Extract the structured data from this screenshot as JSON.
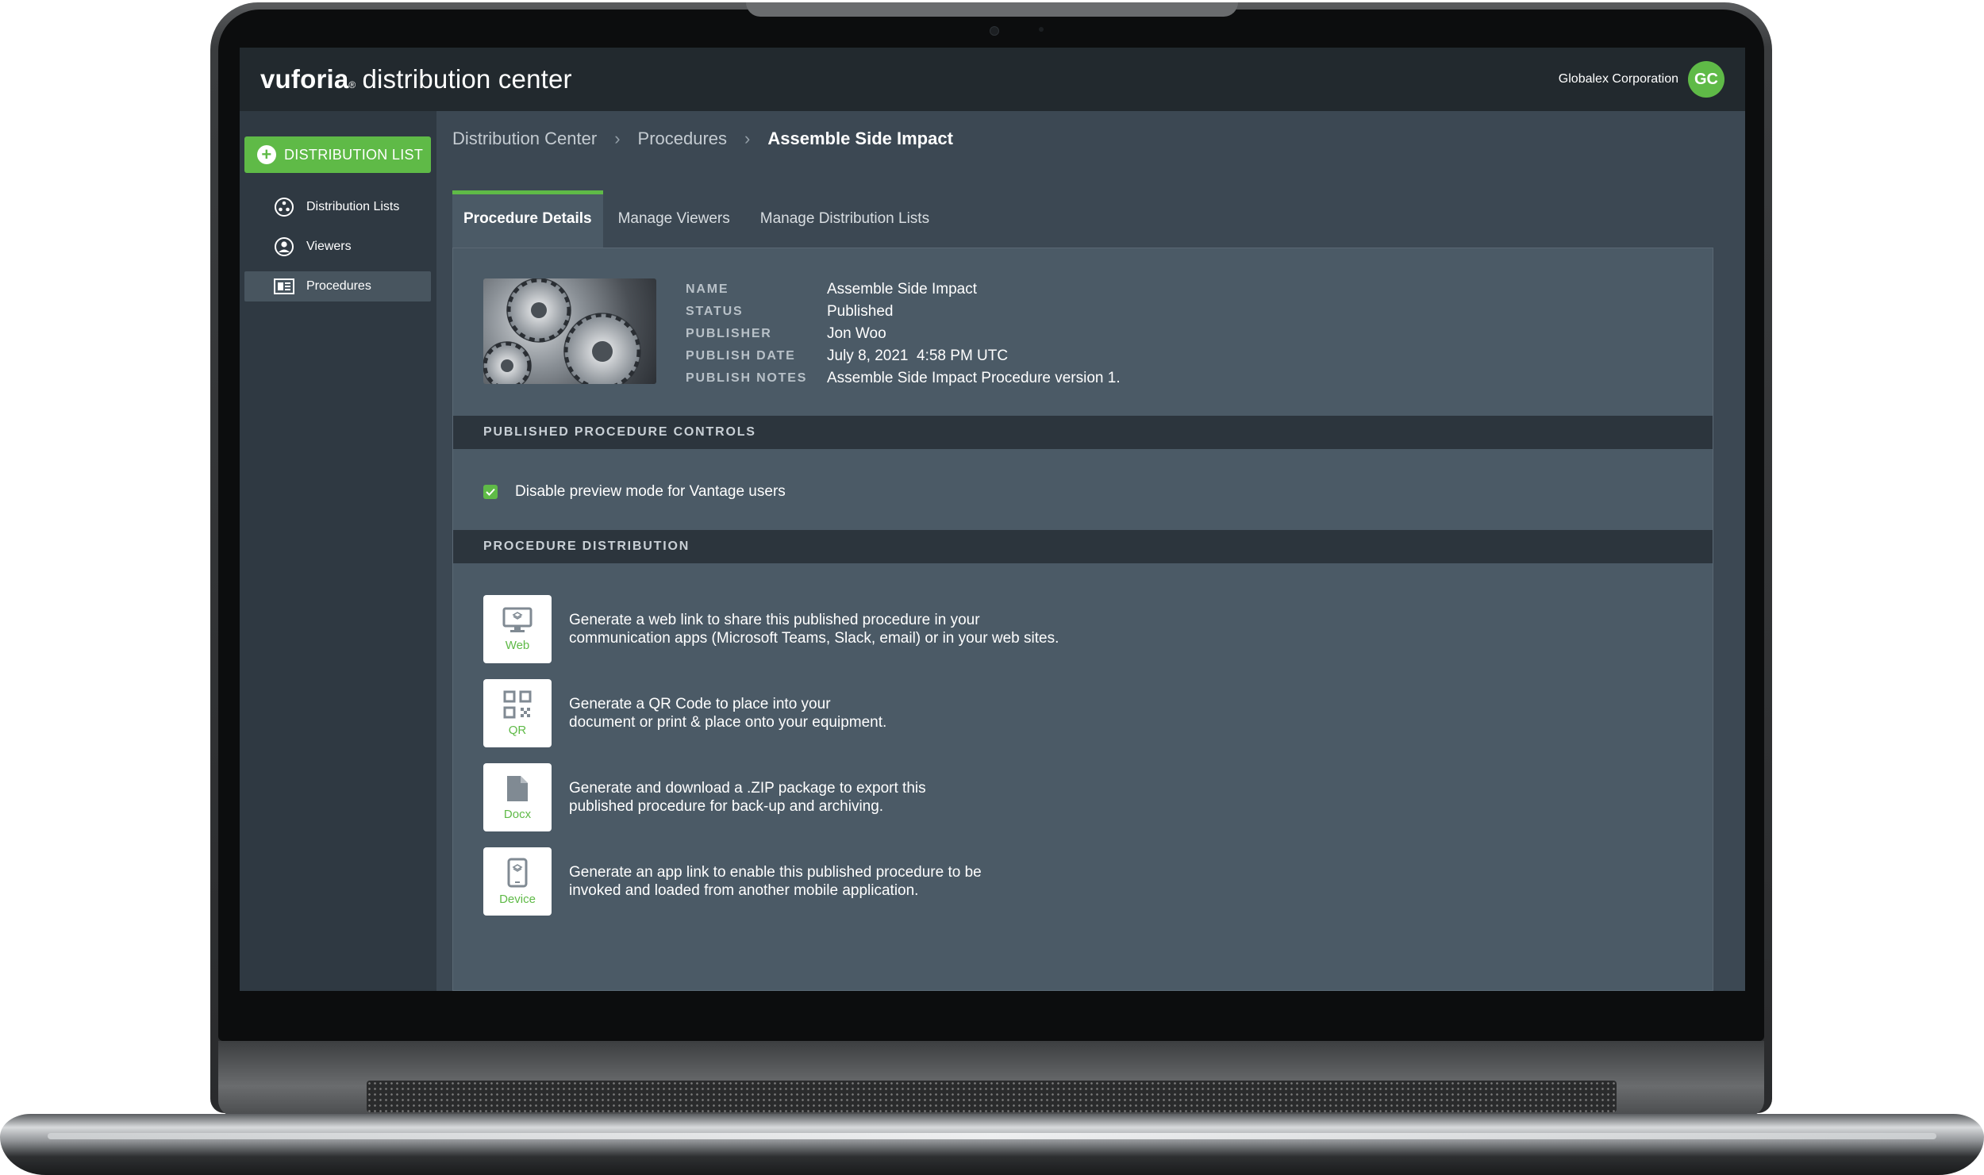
{
  "app": {
    "brand_bold": "vuforia",
    "brand_mark": "®",
    "brand_rest": "distribution center",
    "org_name": "Globalex Corporation",
    "avatar_initials": "GC"
  },
  "sidebar": {
    "primary_button": "DISTRIBUTION LIST",
    "items": [
      {
        "label": "Distribution Lists",
        "icon": "distribution-lists-icon"
      },
      {
        "label": "Viewers",
        "icon": "viewer-icon"
      },
      {
        "label": "Procedures",
        "icon": "procedures-icon",
        "active": true
      }
    ]
  },
  "breadcrumb": [
    "Distribution Center",
    "Procedures",
    "Assemble Side Impact"
  ],
  "tabs": [
    {
      "label": "Procedure Details",
      "active": true
    },
    {
      "label": "Manage Viewers"
    },
    {
      "label": "Manage Distribution Lists"
    }
  ],
  "details": {
    "name_label": "NAME",
    "name": "Assemble Side Impact",
    "status_label": "STATUS",
    "status": "Published",
    "publisher_label": "PUBLISHER",
    "publisher": "Jon Woo",
    "date_label": "PUBLISH DATE",
    "date": "July 8, 2021  4:58 PM UTC",
    "notes_label": "PUBLISH NOTES",
    "notes": "Assemble Side Impact Procedure version 1."
  },
  "controls": {
    "header": "PUBLISHED PROCEDURE CONTROLS",
    "checkbox_label": "Disable preview mode for Vantage users",
    "checked": true
  },
  "distribution": {
    "header": "PROCEDURE DISTRIBUTION",
    "items": [
      {
        "label": "Web",
        "icon": "web-monitor-icon",
        "line1": "Generate a web link to share this published procedure in your",
        "line2": "communication apps (Microsoft Teams, Slack, email) or in your web sites."
      },
      {
        "label": "QR",
        "icon": "qr-code-icon",
        "line1": "Generate a QR Code to place into your",
        "line2": "document or print & place onto your equipment."
      },
      {
        "label": "Docx",
        "icon": "document-icon",
        "line1": "Generate and download a .ZIP package to export this",
        "line2": "published procedure for back-up and archiving."
      },
      {
        "label": "Device",
        "icon": "mobile-device-icon",
        "line1": "Generate an app link to enable this published procedure to be",
        "line2": "invoked and loaded from another mobile application."
      }
    ]
  },
  "colors": {
    "accent": "#5fba47",
    "topbar": "#22292e",
    "panel": "#4b5a66"
  }
}
